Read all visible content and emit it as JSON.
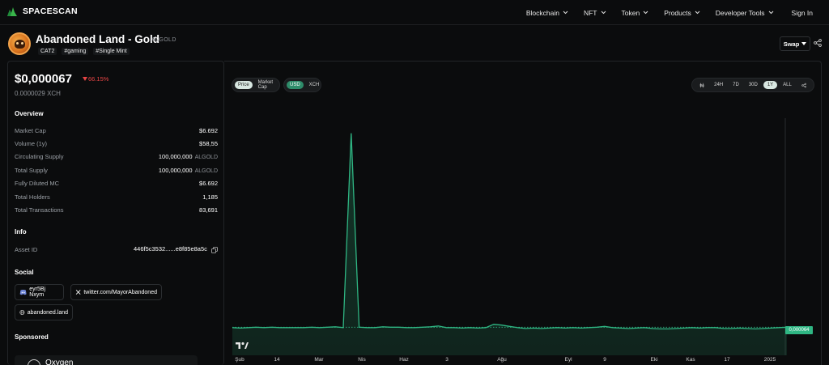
{
  "brand": {
    "name": "SPACESCAN"
  },
  "nav": {
    "items": [
      {
        "label": "Blockchain"
      },
      {
        "label": "NFT"
      },
      {
        "label": "Token"
      },
      {
        "label": "Products"
      },
      {
        "label": "Developer Tools"
      }
    ],
    "signin": "Sign In"
  },
  "token": {
    "name": "Abandoned Land - Gold",
    "symbol": "ALGOLD",
    "tags": [
      "CAT2",
      "#gaming",
      "#Single Mint"
    ],
    "swap_label": "Swap"
  },
  "price": {
    "usd": "$0,000067",
    "change": "66.15%",
    "xch": "0.0000029",
    "xch_unit": "XCH"
  },
  "overview": {
    "title": "Overview",
    "rows": [
      {
        "k": "Market Cap",
        "v": "$6.692",
        "unit": ""
      },
      {
        "k": "Volume (1y)",
        "v": "$58,55",
        "unit": ""
      },
      {
        "k": "Circulating Supply",
        "v": "100,000,000",
        "unit": "ALGOLD"
      },
      {
        "k": "Total Supply",
        "v": "100,000,000",
        "unit": "ALGOLD"
      },
      {
        "k": "Fully Diluted MC",
        "v": "$6.692",
        "unit": ""
      },
      {
        "k": "Total Holders",
        "v": "1,185",
        "unit": ""
      },
      {
        "k": "Total Transactions",
        "v": "83,691",
        "unit": ""
      }
    ]
  },
  "info": {
    "title": "Info",
    "asset_id_label": "Asset ID",
    "asset_id_value": "446f5c3532......e8f85e8a5c"
  },
  "social": {
    "title": "Social",
    "discord": "eyr5Bj Nxym",
    "twitter": "twitter.com/MayorAbandoned",
    "website": "abandoned.land"
  },
  "sponsored": {
    "title": "Sponsored",
    "card_name": "Oxygen"
  },
  "chart_controls": {
    "metric": [
      "Price",
      "Market Cap"
    ],
    "currency": [
      "USD",
      "XCH"
    ],
    "ranges": [
      "24H",
      "7D",
      "30D",
      "1Y",
      "ALL"
    ]
  },
  "chart_data": {
    "type": "area",
    "x_ticks": [
      "Şub",
      "14",
      "Mar",
      "Nis",
      "Haz",
      "3",
      "Ağu",
      "Eyl",
      "9",
      "Eki",
      "Kas",
      "17",
      "2025"
    ],
    "values": [
      6.6e-05,
      6.5e-05,
      6.6e-05,
      6.7e-05,
      6.6e-05,
      6.7e-05,
      6.6e-05,
      6.6e-05,
      6.6e-05,
      6.6e-05,
      6.7e-05,
      6.6e-05,
      6.7e-05,
      6.8e-05,
      6.6e-05,
      0.00053,
      6.7e-05,
      6.6e-05,
      6.6e-05,
      6.8e-05,
      6.7e-05,
      6.7e-05,
      6.6e-05,
      6.6e-05,
      6.7e-05,
      6.8e-05,
      7e-05,
      6.6e-05,
      6.6e-05,
      6.5e-05,
      6.6e-05,
      6.5e-05,
      6.6e-05,
      7.4e-05,
      7.2e-05,
      6.9e-05,
      6.6e-05,
      6.4e-05,
      6.5e-05,
      6.4e-05,
      6.5e-05,
      6.6e-05,
      6.5e-05,
      6.6e-05,
      6.5e-05,
      6.6e-05,
      6.7e-05,
      6.9e-05,
      6.6e-05,
      6.5e-05,
      6.4e-05,
      6.5e-05,
      6.6e-05,
      6.4e-05,
      6.3e-05,
      6.3e-05,
      6.4e-05,
      6.5e-05,
      6.6e-05,
      6.5e-05,
      6.6e-05,
      6.6e-05,
      6.4e-05,
      6.4e-05,
      6.5e-05,
      6.4e-05,
      6.3e-05,
      6.4e-05,
      6.5e-05,
      6.6e-05,
      6.7e-05
    ],
    "last_value_label": "0,000064",
    "color": "#2fb683"
  }
}
